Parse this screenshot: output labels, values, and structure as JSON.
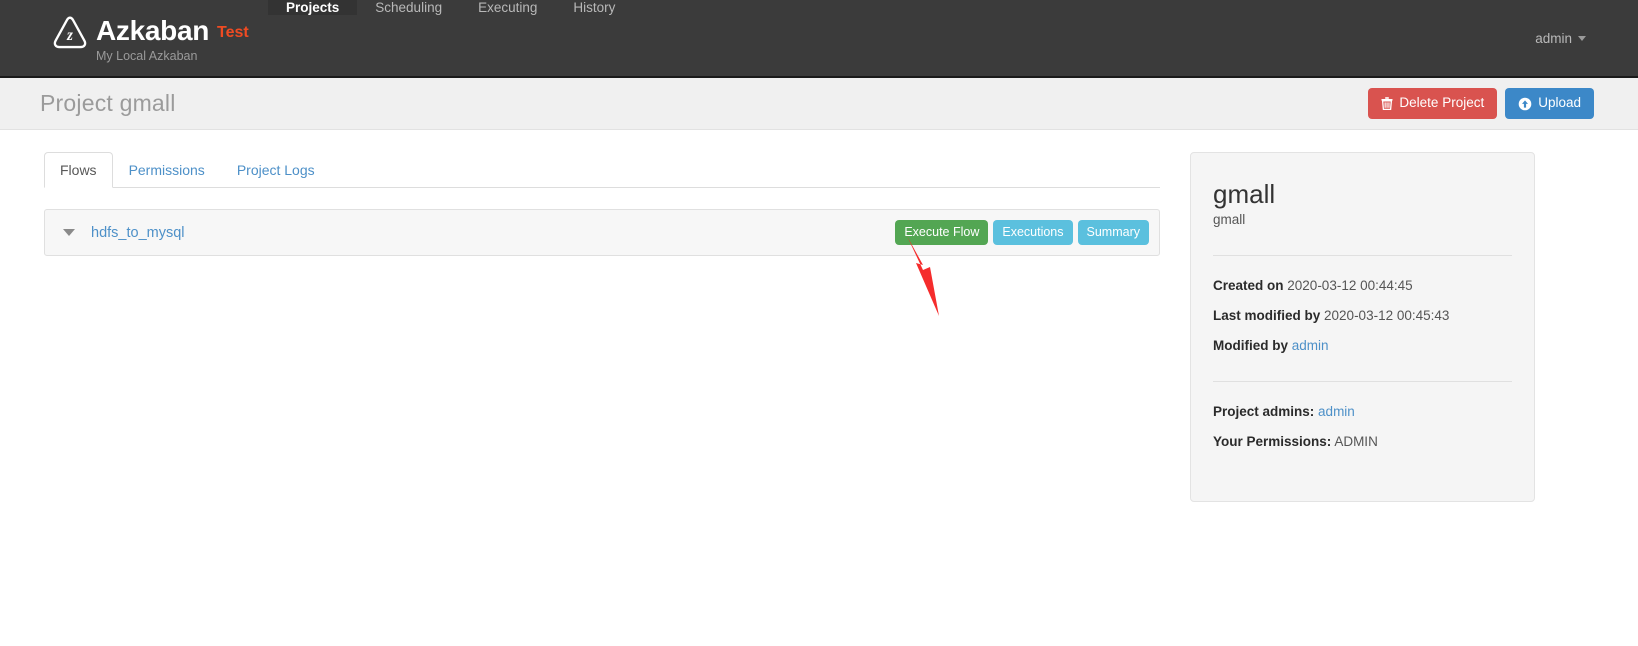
{
  "navbar": {
    "brand_name": "Azkaban",
    "brand_env": "Test",
    "brand_subtitle": "My Local Azkaban",
    "logo_icon": "azkaban-triangle-z-logo",
    "items": [
      {
        "label": "Projects",
        "active": true
      },
      {
        "label": "Scheduling",
        "active": false
      },
      {
        "label": "Executing",
        "active": false
      },
      {
        "label": "History",
        "active": false
      }
    ],
    "user": {
      "label": "admin",
      "caret_icon": "caret-down-icon"
    }
  },
  "page_header": {
    "title": "Project gmall",
    "delete_button": {
      "label": "Delete Project",
      "icon": "trash-icon",
      "color": "#d9534f"
    },
    "upload_button": {
      "label": "Upload",
      "icon": "upload-circle-arrow-icon",
      "color": "#3c88c8"
    }
  },
  "tabs": [
    {
      "label": "Flows",
      "active": true
    },
    {
      "label": "Permissions",
      "active": false
    },
    {
      "label": "Project Logs",
      "active": false
    }
  ],
  "flows": [
    {
      "caret_icon": "chevron-down-icon",
      "name": "hdfs_to_mysql",
      "actions": [
        {
          "label": "Execute Flow",
          "style": "success",
          "color": "#53a653"
        },
        {
          "label": "Executions",
          "style": "info",
          "color": "#5bc0de"
        },
        {
          "label": "Summary",
          "style": "info",
          "color": "#5bc0de"
        }
      ]
    }
  ],
  "side_panel": {
    "title": "gmall",
    "subtitle": "gmall",
    "meta": [
      {
        "label": "Created on",
        "value": "2020-03-12 00:44:45",
        "link": false
      },
      {
        "label": "Last modified by",
        "value": "2020-03-12 00:45:43",
        "link": false
      },
      {
        "label": "Modified by",
        "value": "admin",
        "link": true
      }
    ],
    "permissions": [
      {
        "label": "Project admins:",
        "value": "admin",
        "link": true
      },
      {
        "label": "Your Permissions:",
        "value": "ADMIN",
        "link": false
      }
    ]
  },
  "annotation": {
    "arrow_icon": "red-arrow-pointing-to-execute-flow",
    "color": "#f52c2c"
  }
}
